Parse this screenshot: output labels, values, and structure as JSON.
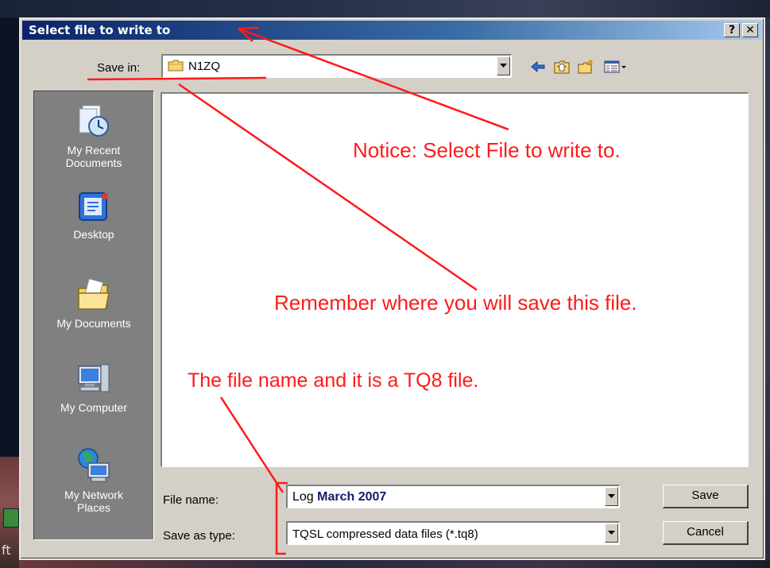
{
  "dialog": {
    "title": "Select file to write to",
    "help_glyph": "?",
    "close_glyph": "✕"
  },
  "toolbar": {
    "save_in_label": "Save in:",
    "save_in_value": "N1ZQ",
    "icons": [
      "back-arrow-icon",
      "up-folder-icon",
      "new-folder-icon",
      "views-menu-icon"
    ]
  },
  "places": [
    {
      "label_line1": "My Recent",
      "label_line2": "Documents",
      "icon": "recent-documents-icon"
    },
    {
      "label_line1": "Desktop",
      "label_line2": "",
      "icon": "desktop-icon"
    },
    {
      "label_line1": "My Documents",
      "label_line2": "",
      "icon": "my-documents-icon"
    },
    {
      "label_line1": "My Computer",
      "label_line2": "",
      "icon": "my-computer-icon"
    },
    {
      "label_line1": "My Network",
      "label_line2": "Places",
      "icon": "network-places-icon"
    }
  ],
  "form": {
    "file_name_label": "File name:",
    "file_name_value_part1": "Log ",
    "file_name_value_part2": "March 2007",
    "save_as_type_label": "Save as type:",
    "save_as_type_value": "TQSL compressed data files (*.tq8)",
    "save_button": "Save",
    "cancel_button": "Cancel"
  },
  "annotations": {
    "note1": "Notice: Select File to write to.",
    "note2": "Remember where you will save this file.",
    "note3": "The file name and it is a TQ8 file.",
    "color": "#ff1a1a"
  },
  "background": {
    "left_edge_text": "ft"
  }
}
